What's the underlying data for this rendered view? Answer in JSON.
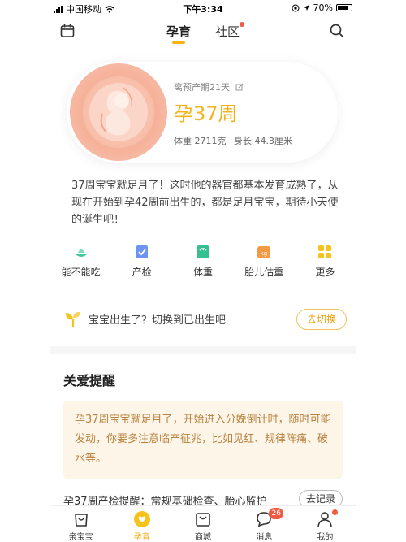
{
  "status_bar": {
    "carrier": "中国移动",
    "time": "下午3:34",
    "battery": "70%"
  },
  "header": {
    "tabs": [
      {
        "label": "孕育",
        "active": true
      },
      {
        "label": "社区",
        "active": false,
        "has_dot": true
      }
    ]
  },
  "hero": {
    "due_text": "离预产期21天",
    "week_title": "孕37周",
    "weight": "体重 2711克",
    "length": "身长 44.3厘米"
  },
  "description": "37周宝宝就足月了！这时他的器官都基本发育成熟了，从现在开始到孕42周前出生的，都是足月宝宝，期待小天使的诞生吧！",
  "tools": [
    {
      "label": "能不能吃",
      "icon": "bowl-icon",
      "color": "#3fc7a0"
    },
    {
      "label": "产检",
      "icon": "clipboard-icon",
      "color": "#6d93f5"
    },
    {
      "label": "体重",
      "icon": "scale-icon",
      "color": "#35c08f"
    },
    {
      "label": "胎儿估重",
      "icon": "kg-weight-icon",
      "color": "#f39a45"
    },
    {
      "label": "更多",
      "icon": "grid-icon",
      "color": "#f6c21c"
    }
  ],
  "switch_row": {
    "text": "宝宝出生了？切换到已出生吧",
    "button": "去切换"
  },
  "care": {
    "title": "关爱提醒",
    "text": "孕37周宝宝就足月了，开始进入分娩倒计时，随时可能发动，你要多注意临产征兆，比如见红、规律阵痛、破水等。"
  },
  "checkup": {
    "text": "孕37周产检提醒：常规基础检查、胎心监护",
    "button": "去记录"
  },
  "bottom_nav": [
    {
      "label": "亲宝宝",
      "icon": "baby-bag-icon"
    },
    {
      "label": "孕育",
      "icon": "heart-icon",
      "active": true
    },
    {
      "label": "商城",
      "icon": "shopping-bag-icon"
    },
    {
      "label": "消息",
      "icon": "chat-bubble-icon",
      "badge": "26"
    },
    {
      "label": "我的",
      "icon": "person-icon",
      "has_dot": true
    }
  ],
  "colors": {
    "accent": "#f2b31b",
    "badge": "#f25a43",
    "care_bg": "#fdf6e8",
    "care_text": "#b9813f"
  }
}
